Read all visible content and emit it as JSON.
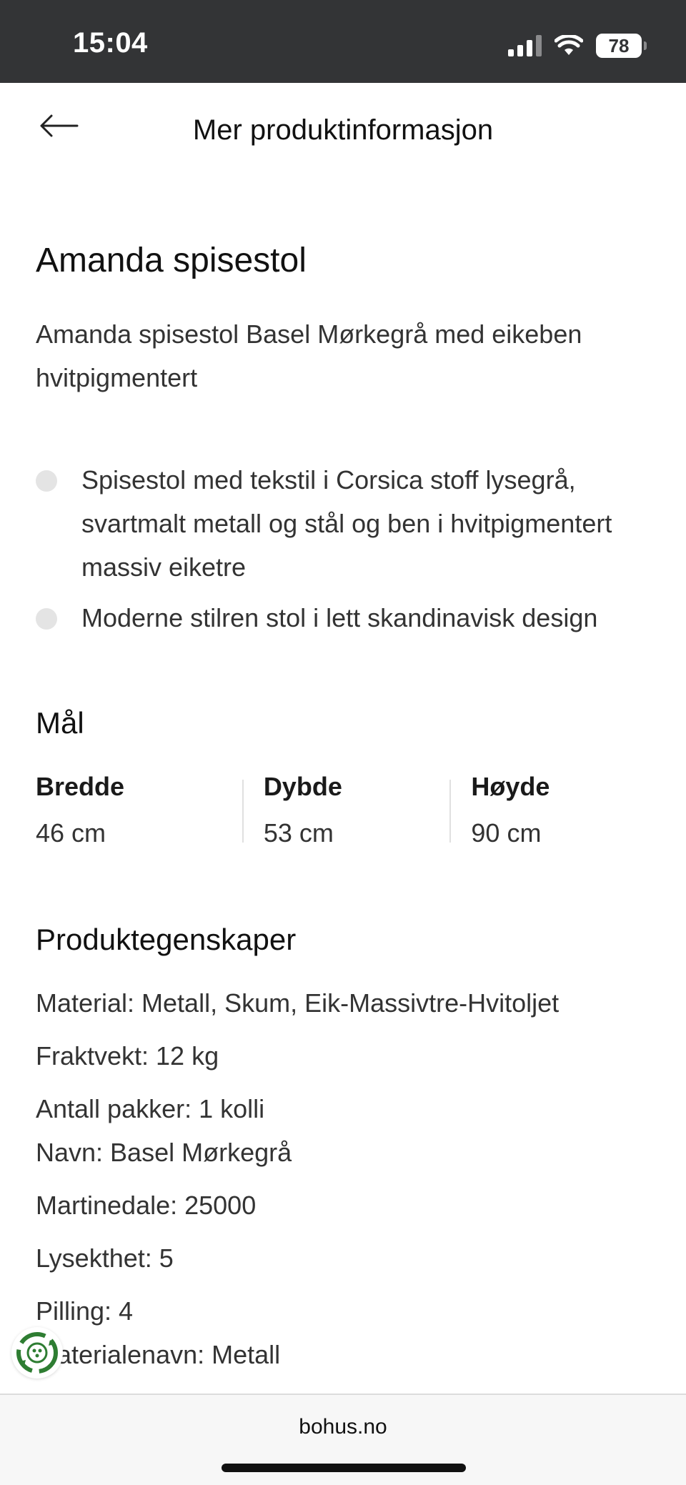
{
  "status_bar": {
    "time": "15:04",
    "battery": "78",
    "signal_icon": "signal-bars-icon",
    "wifi_icon": "wifi-icon"
  },
  "header": {
    "title": "Mer produktinformasjon",
    "back_icon": "arrow-left-icon"
  },
  "product": {
    "title": "Amanda spisestol",
    "description": "Amanda spisestol Basel Mørkegrå med eikeben hvitpigmentert",
    "bullets": [
      "Spisestol med tekstil i Corsica stoff lysegrå, svartmalt metall og stål og ben i hvitpigmentert massiv eiketre",
      "Moderne stilren stol i lett skandinavisk design"
    ]
  },
  "dimensions": {
    "title": "Mål",
    "items": [
      {
        "label": "Bredde",
        "value": "46 cm"
      },
      {
        "label": "Dybde",
        "value": "53 cm"
      },
      {
        "label": "Høyde",
        "value": "90 cm"
      }
    ]
  },
  "properties": {
    "title": "Produktegenskaper",
    "items": [
      "Material: Metall, Skum, Eik-Massivtre-Hvitoljet",
      "Fraktvekt: 12 kg",
      "Antall pakker: 1 kolli",
      "Navn: Basel Mørkegrå",
      "Martinedale: 25000",
      "Lysekthet: 5",
      "Pilling: 4",
      "Materialenavn: Metall"
    ]
  },
  "floating_badge": {
    "icon": "recycle-badge-icon",
    "color": "#2e7d32"
  },
  "browser": {
    "url": "bohus.no"
  },
  "colors": {
    "status_bar_bg": "#333436",
    "bullet_dot": "#e4e4e4",
    "badge_green": "#2e7d32"
  }
}
